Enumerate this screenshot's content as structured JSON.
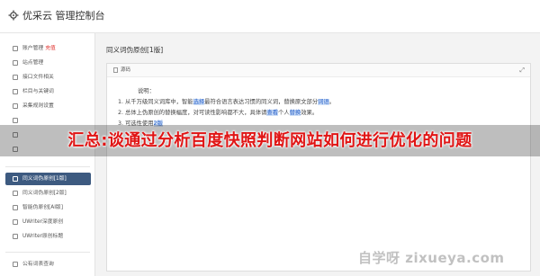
{
  "header": {
    "title": "优采云 管理控制台",
    "icon": "gear-icon"
  },
  "sidebar": {
    "items": [
      {
        "label": "账户管理",
        "badge": "充值",
        "icon": "chart-icon"
      },
      {
        "label": "站点管理",
        "badge": "",
        "icon": "list-icon"
      },
      {
        "label": "接口文件相关",
        "badge": "",
        "icon": "upload-icon"
      },
      {
        "label": "栏目与关键词",
        "badge": "",
        "icon": "tag-icon"
      },
      {
        "label": "采集规则设置",
        "badge": "",
        "icon": "cog-icon"
      },
      {
        "label": "",
        "badge": "",
        "icon": "cog-icon"
      },
      {
        "label": "",
        "badge": "",
        "icon": "edit-icon"
      },
      {
        "label": "",
        "badge": "",
        "icon": "clock-icon"
      }
    ],
    "tools": [
      {
        "label": "同义词伪原创[1版]",
        "active": true,
        "icon": "refresh-icon"
      },
      {
        "label": "同义词伪原创[2版]",
        "active": false,
        "icon": "refresh-icon"
      },
      {
        "label": "智能伪原创[AI版]",
        "active": false,
        "icon": "refresh-icon"
      },
      {
        "label": "UWriter深度原创",
        "active": false,
        "icon": "edit-icon"
      },
      {
        "label": "UWriter原创标题",
        "active": false,
        "icon": "edit-icon"
      }
    ],
    "bottom": [
      {
        "label": "公有词表查询",
        "icon": "book-icon"
      }
    ]
  },
  "main": {
    "title": "同义词伪原创[1版]",
    "editor": {
      "toolbar_label": "源码",
      "expand_icon": "⤢",
      "heading": "说明：",
      "line1": {
        "a": "1. 从千万级同义词库中，智能",
        "b": "选择",
        "c": "最符合语言表达习惯的同义词，替换原文部分",
        "d": "词语",
        "e": "。"
      },
      "line2": {
        "a": "2. 总体上伪原创的替换幅度，对可读性影响都不大，具体请",
        "b": "查看",
        "c": "个人",
        "d": "替换",
        "e": "效果。"
      },
      "line3": {
        "a": "3. 可选性使用",
        "b": "2版"
      }
    }
  },
  "overlay": {
    "banner_text": "汇总:谈通过分析百度快照判断网站如何进行优化的问题",
    "watermark": "自学呀 zixueya.com"
  }
}
